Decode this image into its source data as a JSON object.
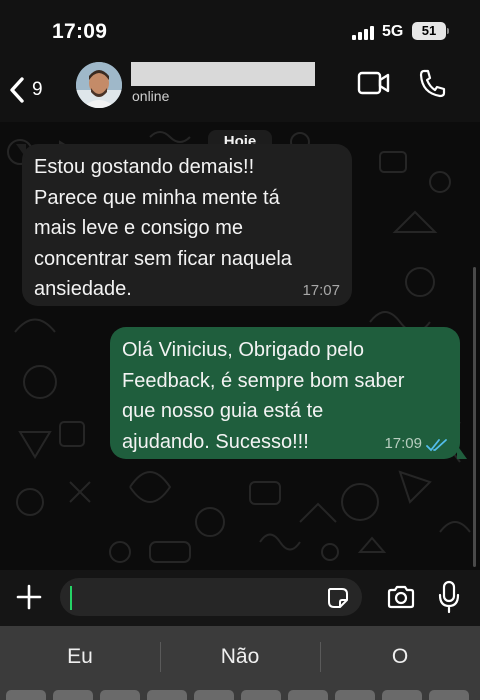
{
  "status_bar": {
    "time": "17:09",
    "network": "5G",
    "battery": "51"
  },
  "header": {
    "back_count": "9",
    "contact_name": "",
    "presence": "online",
    "icons": [
      "chevron-left-icon",
      "video-call-icon",
      "phone-icon"
    ]
  },
  "chat": {
    "day_label": "Hoje",
    "messages": [
      {
        "direction": "incoming",
        "lines": [
          "Estou gostando demais!!",
          "Parece que minha mente tá",
          "mais leve e consigo me",
          "concentrar sem ficar naquela",
          "ansiedade."
        ],
        "time": "17:07"
      },
      {
        "direction": "outgoing",
        "lines": [
          "Olá Vinicius, Obrigado pelo",
          "Feedback, é sempre bom saber",
          "que nosso guia está te",
          "ajudando. Sucesso!!!"
        ],
        "time": "17:09",
        "status": "read"
      }
    ]
  },
  "composer": {
    "value": "",
    "icons": [
      "plus-icon",
      "sticker-icon",
      "camera-icon",
      "microphone-icon"
    ]
  },
  "keyboard": {
    "suggestions": [
      "Eu",
      "Não",
      "O"
    ]
  },
  "colors": {
    "incoming_bubble": "#1f1f1f",
    "outgoing_bubble": "#1f5e3d",
    "read_ticks": "#53bdeb",
    "accent": "#25d366"
  }
}
